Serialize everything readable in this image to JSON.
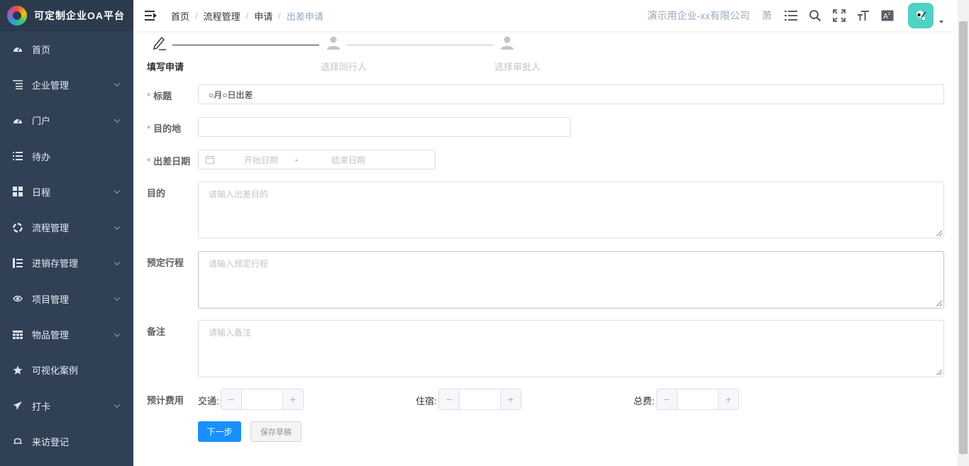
{
  "app": {
    "title": "可定制企业OA平台"
  },
  "sidebar": {
    "items": [
      {
        "label": "首页",
        "icon": "dashboard-icon",
        "has_children": false
      },
      {
        "label": "企业管理",
        "icon": "tree-list-icon",
        "has_children": true
      },
      {
        "label": "门户",
        "icon": "dashboard-icon",
        "has_children": true
      },
      {
        "label": "待办",
        "icon": "list-icon",
        "has_children": false
      },
      {
        "label": "日程",
        "icon": "grid-icon",
        "has_children": true
      },
      {
        "label": "流程管理",
        "icon": "flow-icon",
        "has_children": true
      },
      {
        "label": "进销存管理",
        "icon": "tree-table-icon",
        "has_children": true
      },
      {
        "label": "项目管理",
        "icon": "eye-icon",
        "has_children": true
      },
      {
        "label": "物品管理",
        "icon": "table-icon",
        "has_children": true
      },
      {
        "label": "可视化案例",
        "icon": "star-icon",
        "has_children": false
      },
      {
        "label": "打卡",
        "icon": "send-icon",
        "has_children": true
      },
      {
        "label": "来访登记",
        "icon": "guide-icon",
        "has_children": false
      }
    ]
  },
  "header": {
    "breadcrumb": [
      "首页",
      "流程管理",
      "申请",
      "出差申请"
    ],
    "breadcrumb_sep": "/",
    "company": "演示用企业-xx有限公司",
    "user_short": "萧"
  },
  "steps": [
    {
      "title": "填写申请",
      "status": "active",
      "icon": "edit-icon"
    },
    {
      "title": "选择同行人",
      "status": "wait",
      "icon": "user-icon"
    },
    {
      "title": "选择审批人",
      "status": "wait",
      "icon": "user-icon"
    }
  ],
  "form": {
    "title": {
      "label": "标题",
      "required": true,
      "value": "○月○日出差"
    },
    "destination": {
      "label": "目的地",
      "required": true,
      "value": ""
    },
    "date": {
      "label": "出差日期",
      "required": true,
      "start_placeholder": "开始日期",
      "separator": "-",
      "end_placeholder": "结束日期"
    },
    "purpose": {
      "label": "目的",
      "placeholder": "请输入出差目的"
    },
    "itinerary": {
      "label": "预定行程",
      "placeholder": "请输入预定行程"
    },
    "remark": {
      "label": "备注",
      "placeholder": "请输入备注"
    },
    "cost": {
      "label": "预计费用",
      "traffic_label": "交通:",
      "lodging_label": "住宿:",
      "total_label": "总费:",
      "minus": "−",
      "plus": "+"
    }
  },
  "buttons": {
    "next": "下一步",
    "save_draft": "保存草稿"
  },
  "colors": {
    "sidebar_bg": "#304156",
    "primary": "#1890ff",
    "required": "#f56c6c",
    "avatar_bg": "#4fd1c5"
  }
}
